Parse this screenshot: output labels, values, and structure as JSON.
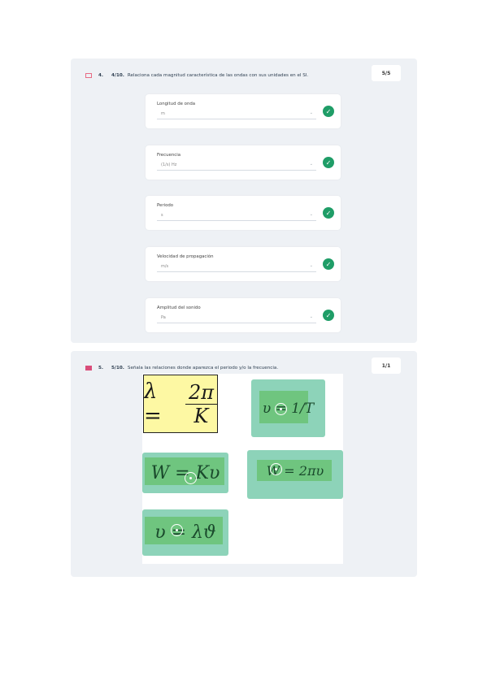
{
  "q4": {
    "flag_icon": "flag-outline-icon",
    "number": "4.",
    "code": "4/10.",
    "text": "Relaciona cada magnitud característica de las ondas con sus unidades en el SI.",
    "score": "5/5",
    "items": [
      {
        "label": "Longitud de onda",
        "value": "m"
      },
      {
        "label": "Frecuencia",
        "value": "(1/s) Hz"
      },
      {
        "label": "Periodo",
        "value": "s"
      },
      {
        "label": "Velocidad de propagación",
        "value": "m/s"
      },
      {
        "label": "Amplitud del sonido",
        "value": "Pa"
      }
    ],
    "check_icon": "check-circle-icon",
    "chevron_icon": "chevron-down-icon"
  },
  "q5": {
    "flag_icon": "flag-filled-icon",
    "number": "5.",
    "code": "5/10.",
    "text": "Señala las relaciones donde aparezca el periodo y/o la frecuencia.",
    "score": "1/1",
    "formulas": {
      "f1": {
        "lhs": "λ =",
        "num": "2π",
        "den": "K"
      },
      "f2": {
        "text": "υ = 1/T"
      },
      "f3": {
        "text": "W = Kυ"
      },
      "f4": {
        "text": "W = 2πυ"
      },
      "f5": {
        "text": "υ = λϑ"
      }
    },
    "target_icon": "hotspot-target-icon"
  },
  "colors": {
    "success": "#1f9d67",
    "selected_tile": "#8dd3b9",
    "highlight": "#6fc57f",
    "image_bg": "#fdf8a3",
    "flag": "#d94e7a"
  }
}
